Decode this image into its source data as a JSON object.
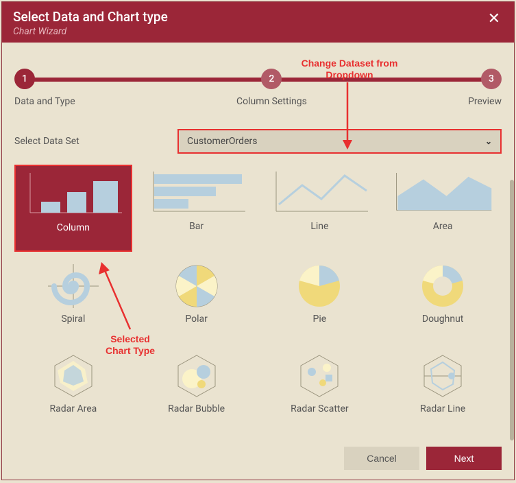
{
  "dialog": {
    "title": "Select Data and Chart type",
    "subtitle": "Chart Wizard",
    "close": "✕"
  },
  "stepper": {
    "steps": [
      {
        "num": "1",
        "label": "Data and Type"
      },
      {
        "num": "2",
        "label": "Column Settings"
      },
      {
        "num": "3",
        "label": "Preview"
      }
    ]
  },
  "dataset": {
    "label": "Select Data Set",
    "value": "CustomerOrders",
    "chevron": "⌄"
  },
  "charts": [
    {
      "name": "Column",
      "selected": true
    },
    {
      "name": "Bar"
    },
    {
      "name": "Line"
    },
    {
      "name": "Area"
    },
    {
      "name": "Spiral"
    },
    {
      "name": "Polar"
    },
    {
      "name": "Pie"
    },
    {
      "name": "Doughnut"
    },
    {
      "name": "Radar Area"
    },
    {
      "name": "Radar Bubble"
    },
    {
      "name": "Radar Scatter"
    },
    {
      "name": "Radar Line"
    }
  ],
  "footer": {
    "cancel": "Cancel",
    "next": "Next"
  },
  "annotations": {
    "dropdown": "Change Dataset from\nDropdown",
    "selected": "Selected\nChart Type"
  },
  "colors": {
    "brand": "#9b2638",
    "annotation": "#e83030",
    "surface": "#eae3d0",
    "iconFill": "#b6cfde",
    "iconYellow": "#f0d97a"
  }
}
